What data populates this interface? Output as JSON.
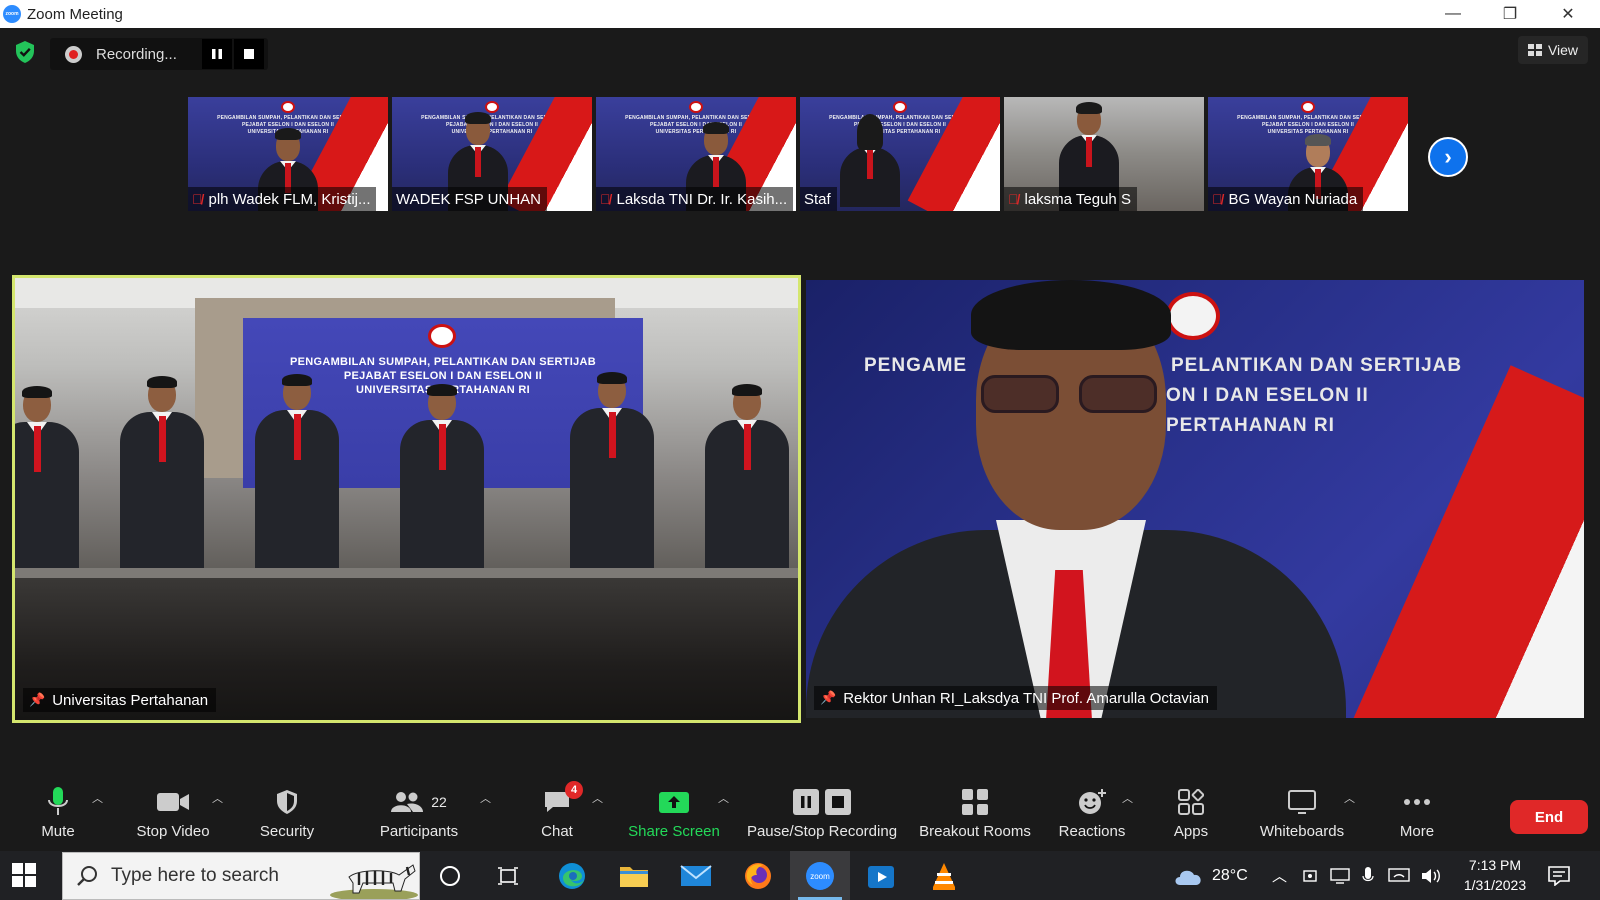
{
  "window": {
    "title": "Zoom Meeting",
    "logo_text": "zoom",
    "controls": {
      "minimize": "—",
      "restore": "❐",
      "close": "✕"
    }
  },
  "top": {
    "recording_status": "Recording...",
    "view_label": "View"
  },
  "thumbnails": [
    {
      "name": "plh Wadek FLM, Kristij...",
      "muted": true,
      "bg": "banner"
    },
    {
      "name": "WADEK FSP UNHAN",
      "muted": false,
      "bg": "banner"
    },
    {
      "name": "Laksda TNI Dr. Ir. Kasih...",
      "muted": true,
      "bg": "banner"
    },
    {
      "name": "Staf",
      "muted": false,
      "bg": "banner"
    },
    {
      "name": "laksma Teguh S",
      "muted": true,
      "bg": "office"
    },
    {
      "name": "BG Wayan Nuriada",
      "muted": true,
      "bg": "banner"
    }
  ],
  "thumb_banner_lines": [
    "PENGAMBILAN SUMPAH, PELANTIKAN DAN SERTIJAB",
    "PEJABAT ESELON I DAN ESELON II",
    "UNIVERSITAS PERTAHANAN RI"
  ],
  "main_tiles": {
    "left": {
      "name": "Universitas Pertahanan",
      "banner_lines": [
        "PENGAMBILAN SUMPAH, PELANTIKAN DAN SERTIJAB",
        "PEJABAT ESELON I DAN ESELON II",
        "UNIVERSITAS PERTAHANAN RI"
      ],
      "active_speaker_color": "#d4e66e"
    },
    "right": {
      "name": "Rektor Unhan RI_Laksdya TNI Prof. Amarulla Octavian",
      "banner_left": "PENGAME",
      "banner_right_lines": [
        "PELANTIKAN DAN SERTIJAB",
        "ON I DAN ESELON II",
        "PERTAHANAN RI"
      ]
    }
  },
  "toolbar": {
    "mute": "Mute",
    "stop_video": "Stop Video",
    "security": "Security",
    "participants": "Participants",
    "participants_count": "22",
    "chat": "Chat",
    "chat_badge": "4",
    "share_screen": "Share Screen",
    "pause_stop_recording": "Pause/Stop Recording",
    "breakout_rooms": "Breakout Rooms",
    "reactions": "Reactions",
    "apps": "Apps",
    "whiteboards": "Whiteboards",
    "more": "More",
    "end": "End"
  },
  "taskbar": {
    "search_placeholder": "Type here to search",
    "weather_temp": "28°C",
    "time": "7:13 PM",
    "date": "1/31/2023"
  },
  "colors": {
    "zoom_blue": "#2d8cff",
    "share_green": "#23d959",
    "end_red": "#e02828",
    "mic_green": "#23d959"
  }
}
